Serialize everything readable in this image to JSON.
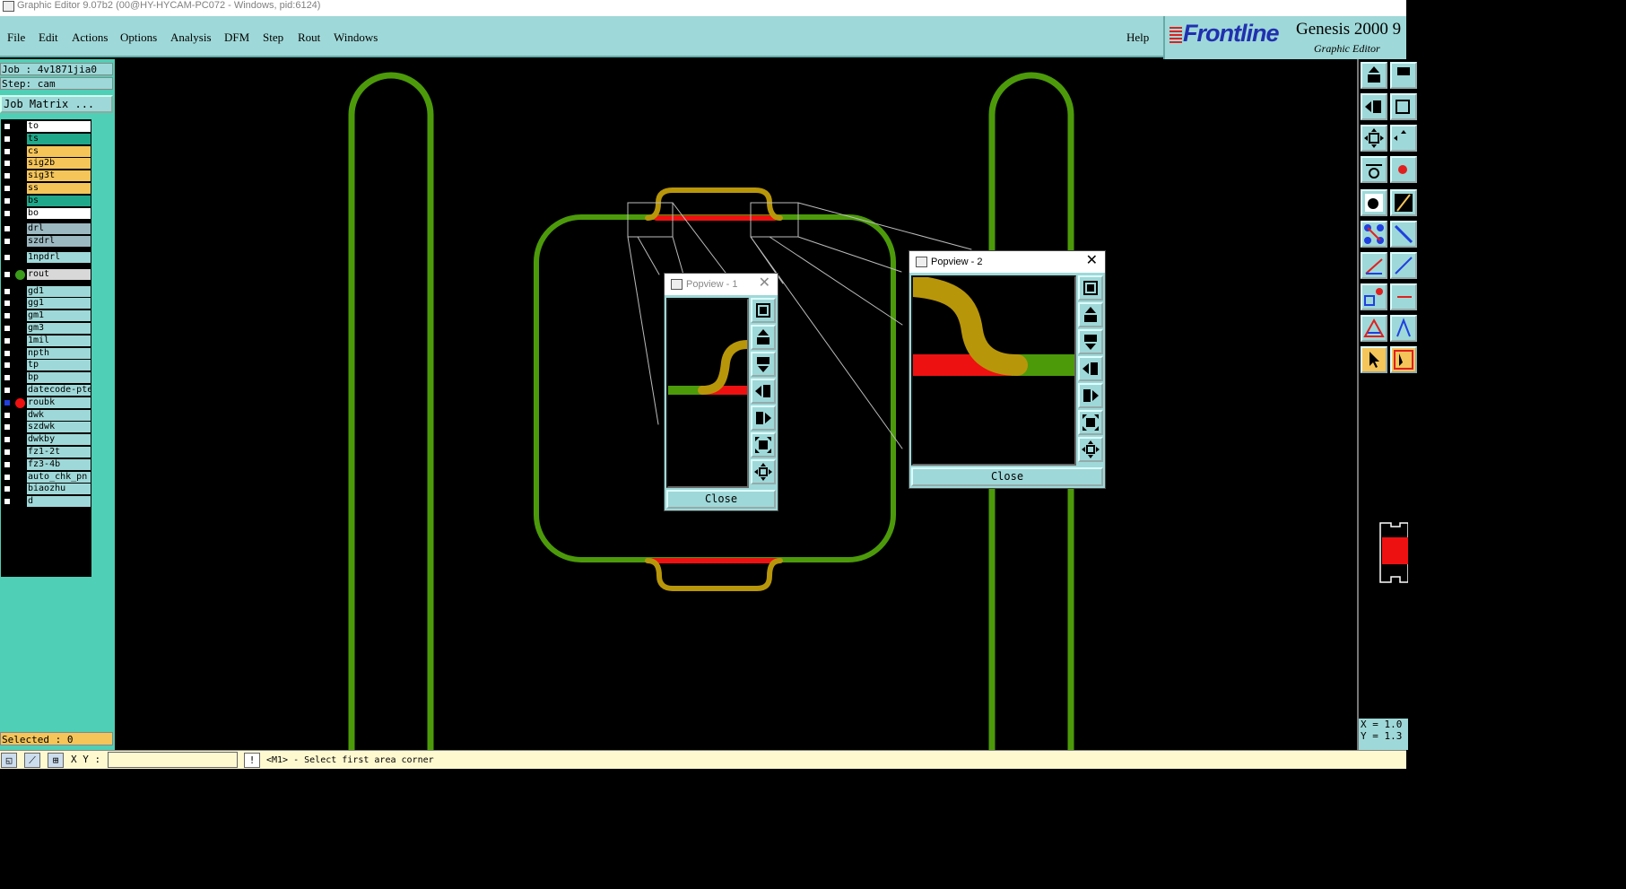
{
  "window": {
    "title": "Graphic Editor 9.07b2 (00@HY-HYCAM-PC072 - Windows, pid:6124)"
  },
  "menu": {
    "file": "File",
    "edit": "Edit",
    "actions": "Actions",
    "options": "Options",
    "analysis": "Analysis",
    "dfm": "DFM",
    "step": "Step",
    "rout": "Rout",
    "windows": "Windows",
    "help": "Help"
  },
  "brand": {
    "logo": "Frontline",
    "product": "Genesis 2000 9",
    "subtitle": "Graphic Editor"
  },
  "job": {
    "job_line": "Job : 4v1871jia0",
    "step_line": "Step: cam",
    "matrix_button": "Job Matrix ..."
  },
  "layers": [
    {
      "name": "to",
      "color": "#ffffff",
      "dot": ""
    },
    {
      "name": "ts",
      "color": "#1fa88a",
      "dot": ""
    },
    {
      "name": "cs",
      "color": "#f5c55a",
      "dot": ""
    },
    {
      "name": "sig2b",
      "color": "#f5c55a",
      "dot": ""
    },
    {
      "name": "sig3t",
      "color": "#f5c55a",
      "dot": ""
    },
    {
      "name": "ss",
      "color": "#f5c55a",
      "dot": ""
    },
    {
      "name": "bs",
      "color": "#1fa88a",
      "dot": ""
    },
    {
      "name": "bo",
      "color": "#ffffff",
      "dot": ""
    },
    {
      "name": "drl",
      "color": "#9cb8c0",
      "dot": ""
    },
    {
      "name": "szdrl",
      "color": "#9cb8c0",
      "dot": ""
    },
    {
      "name": "1npdrl",
      "color": "#9fd8d8",
      "dot": ""
    },
    {
      "name": "rout",
      "color": "#d8d8d8",
      "dot": "#3a9a1a"
    },
    {
      "name": "gd1",
      "color": "#9fd8d8",
      "dot": ""
    },
    {
      "name": "gg1",
      "color": "#9fd8d8",
      "dot": ""
    },
    {
      "name": "gm1",
      "color": "#9fd8d8",
      "dot": ""
    },
    {
      "name": "gm3",
      "color": "#9fd8d8",
      "dot": ""
    },
    {
      "name": "1mil",
      "color": "#9fd8d8",
      "dot": ""
    },
    {
      "name": "npth",
      "color": "#9fd8d8",
      "dot": ""
    },
    {
      "name": "tp",
      "color": "#9fd8d8",
      "dot": ""
    },
    {
      "name": "bp",
      "color": "#9fd8d8",
      "dot": ""
    },
    {
      "name": "datecode-pte",
      "color": "#9fd8d8",
      "dot": ""
    },
    {
      "name": "roubk",
      "color": "#9fd8d8",
      "dot": "#ee1111"
    },
    {
      "name": "dwk",
      "color": "#9fd8d8",
      "dot": ""
    },
    {
      "name": "szdwk",
      "color": "#9fd8d8",
      "dot": ""
    },
    {
      "name": "dwkby",
      "color": "#9fd8d8",
      "dot": ""
    },
    {
      "name": "fz1-2t",
      "color": "#9fd8d8",
      "dot": ""
    },
    {
      "name": "fz3-4b",
      "color": "#9fd8d8",
      "dot": ""
    },
    {
      "name": "auto_chk_pn",
      "color": "#9fd8d8",
      "dot": ""
    },
    {
      "name": "biaozhu",
      "color": "#9fd8d8",
      "dot": ""
    },
    {
      "name": "d",
      "color": "#9fd8d8",
      "dot": ""
    }
  ],
  "selected": "Selected : 0",
  "status": {
    "xy_label": "X Y :",
    "xy_value": "",
    "bang": "!",
    "prompt": "<M1> - Select first area corner"
  },
  "coords": {
    "x": "X = 1.0",
    "y": "Y = 1.3"
  },
  "popview1": {
    "title": "Popview - 1",
    "close_label": "Close"
  },
  "popview2": {
    "title": "Popview - 2",
    "close_label": "Close"
  },
  "colors": {
    "route": "#4c9a0a",
    "trace": "#ee1111",
    "gold": "#b8960a",
    "panel": "#4fcfb6",
    "menubar": "#9fd8d8"
  }
}
